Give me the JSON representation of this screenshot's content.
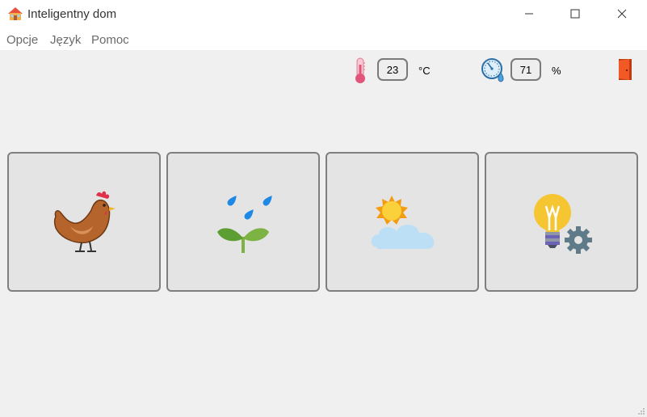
{
  "window": {
    "title": "Inteligentny dom",
    "app_icon": "house-icon",
    "controls": [
      "minimize-icon",
      "maximize-icon",
      "close-icon"
    ]
  },
  "menu": {
    "items": [
      {
        "label": "Opcje"
      },
      {
        "label": "Język"
      },
      {
        "label": "Pomoc"
      }
    ]
  },
  "status": {
    "temperature": {
      "icon": "thermometer-icon",
      "value": "23",
      "unit": "°C"
    },
    "humidity": {
      "icon": "humidity-icon",
      "value": "71",
      "unit": "%"
    },
    "exit": {
      "icon": "door-exit-icon"
    }
  },
  "tiles": [
    {
      "icon": "chicken-icon"
    },
    {
      "icon": "watering-plant-icon"
    },
    {
      "icon": "weather-icon"
    },
    {
      "icon": "lightbulb-settings-icon"
    }
  ],
  "colors": {
    "accent_exit": "#f15a24",
    "tile_background": "#e4e4e4",
    "tile_border": "#7f7f7f"
  }
}
